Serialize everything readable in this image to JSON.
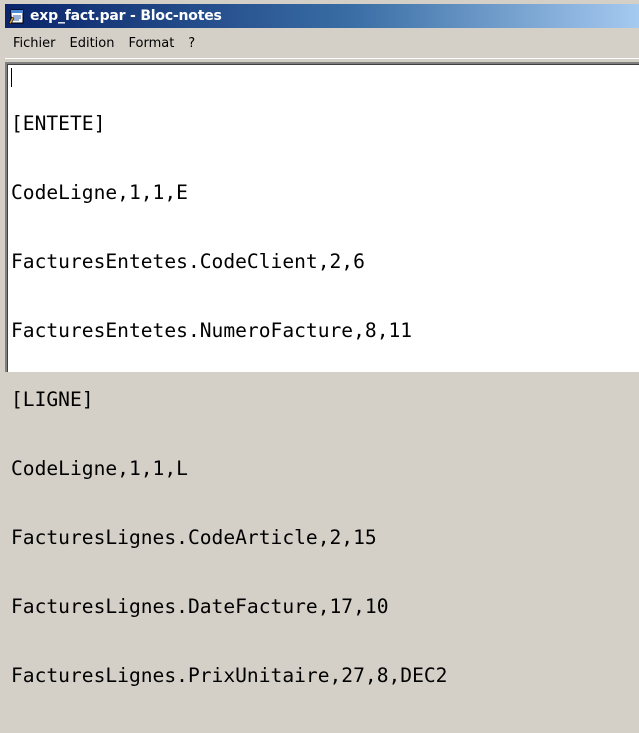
{
  "window": {
    "title": "exp_fact.par - Bloc-notes",
    "icon": "notepad-icon"
  },
  "menu": {
    "items": [
      "Fichier",
      "Edition",
      "Format",
      "?"
    ]
  },
  "editor": {
    "lines": [
      "[ENTETE]",
      "CodeLigne,1,1,E",
      "FacturesEntetes.CodeClient,2,6",
      "FacturesEntetes.NumeroFacture,8,11",
      "[LIGNE]",
      "CodeLigne,1,1,L",
      "FacturesLignes.CodeArticle,2,15",
      "FacturesLignes.DateFacture,17,10",
      "FacturesLignes.PrixUnitaire,27,8,DEC2"
    ]
  },
  "colors": {
    "titlebar_start": "#0a246a",
    "titlebar_end": "#a6caf0",
    "face": "#d4d0c8"
  }
}
